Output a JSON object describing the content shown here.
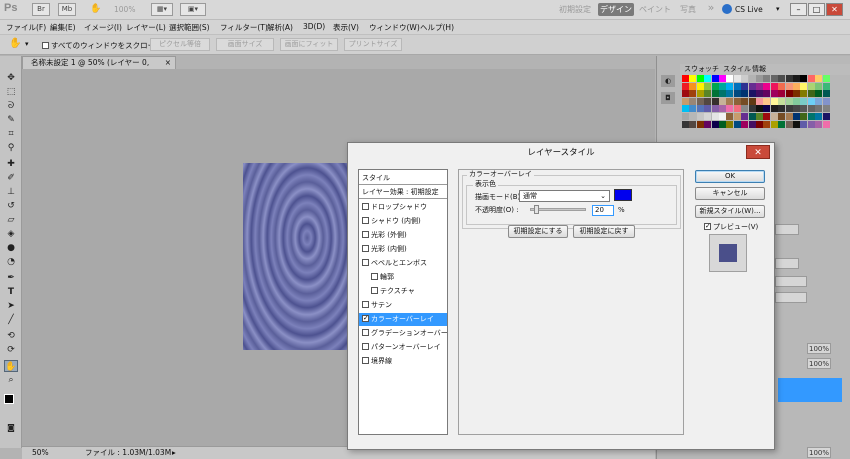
{
  "app": {
    "logo": "Ps",
    "title_icons": [
      "Br",
      "Mb"
    ],
    "zoom_readout": "100%",
    "workspaces": [
      "初期設定",
      "デザイン",
      "ペイント",
      "写真"
    ],
    "more": "»",
    "cslive": "CS Live"
  },
  "window_controls": {
    "minimize": "–",
    "maximize": "□",
    "close": "✕"
  },
  "menu": [
    "ファイル(F)",
    "編集(E)",
    "イメージ(I)",
    "レイヤー(L)",
    "選択範囲(S)",
    "フィルター(T)",
    "解析(A)",
    "3D(D)",
    "表示(V)",
    "ウィンドウ(W)",
    "ヘルプ(H)"
  ],
  "options": {
    "scroll_all_label": "すべてのウィンドウをスクロール",
    "buttons": [
      "ピクセル等倍",
      "画面サイズ",
      "画面にフィット",
      "プリントサイズ"
    ]
  },
  "document": {
    "tab_title": "名称未設定 1 @ 50% (レイヤー 0, RGB/8) *",
    "tab_close": "×"
  },
  "status": {
    "zoom": "50%",
    "file_info": "ファイル : 1.03M/1.03M"
  },
  "panel": {
    "tabs": [
      "スウォッチ",
      "スタイル",
      "情報"
    ],
    "fields": [
      "100%",
      "100%",
      "100%"
    ]
  },
  "dialog": {
    "title": "レイヤースタイル",
    "close": "✕",
    "list_header": "スタイル",
    "list_subheader": "レイヤー効果 : 初期設定",
    "items": [
      {
        "label": "ドロップシャドウ",
        "checked": false
      },
      {
        "label": "シャドウ (内側)",
        "checked": false
      },
      {
        "label": "光彩 (外側)",
        "checked": false
      },
      {
        "label": "光彩 (内側)",
        "checked": false
      },
      {
        "label": "ベベルとエンボス",
        "checked": false
      },
      {
        "label": "輪郭",
        "checked": false
      },
      {
        "label": "テクスチャ",
        "checked": false
      },
      {
        "label": "サテン",
        "checked": false
      },
      {
        "label": "カラーオーバーレイ",
        "checked": true
      },
      {
        "label": "グラデーションオーバーレイ",
        "checked": false
      },
      {
        "label": "パターンオーバーレイ",
        "checked": false
      },
      {
        "label": "境界線",
        "checked": false
      }
    ],
    "section_title": "カラーオーバーレイ",
    "group_title": "表示色",
    "blend_label": "描画モード(B) :",
    "blend_value": "通常",
    "overlay_color": "#0000ee",
    "opacity_label": "不透明度(O) :",
    "opacity_value": "20",
    "opacity_unit": "%",
    "make_default": "初期設定にする",
    "reset_default": "初期設定に戻す",
    "ok": "OK",
    "cancel": "キャンセル",
    "new_style": "新規スタイル(W)...",
    "preview_label": "プレビュー(V)",
    "preview_checked": true
  }
}
